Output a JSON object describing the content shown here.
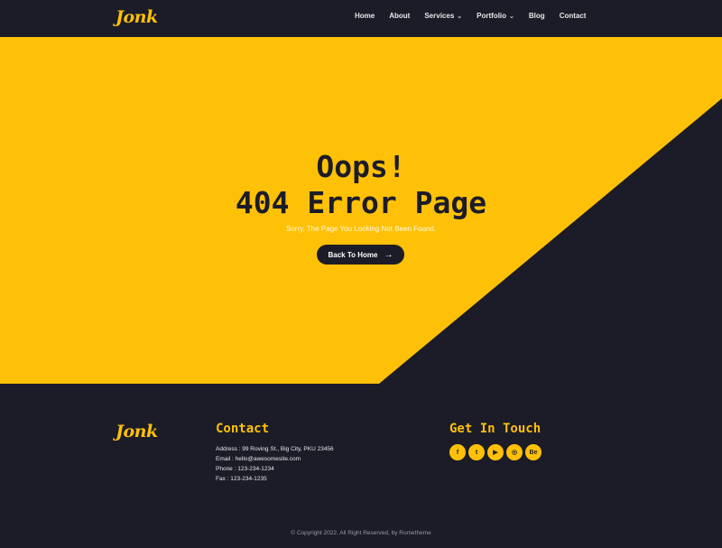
{
  "header": {
    "logo": "Jonk",
    "nav": [
      {
        "label": "Home"
      },
      {
        "label": "About"
      },
      {
        "label": "Services",
        "dropdown": true
      },
      {
        "label": "Portfolio",
        "dropdown": true
      },
      {
        "label": "Blog"
      },
      {
        "label": "Contact"
      }
    ]
  },
  "hero": {
    "title_line1": "Oops!",
    "title_line2": "404 Error Page",
    "subtitle": "Sorry, The Page You Looking Not Been Found.",
    "button_label": "Back To Home"
  },
  "footer": {
    "logo": "Jonk",
    "contact_heading": "Contact",
    "contact_lines": [
      "Address : 99 Roving St., Big City, PKU 23456",
      "Email : hello@awesomesite.com",
      "Phone : 123-234-1234",
      "Fax : 123-234-1235"
    ],
    "touch_heading": "Get In Touch",
    "socials": [
      {
        "icon": "facebook-icon",
        "glyph": "f"
      },
      {
        "icon": "twitter-icon",
        "glyph": "t"
      },
      {
        "icon": "youtube-icon",
        "glyph": "▶"
      },
      {
        "icon": "dribbble-icon",
        "glyph": "◎"
      },
      {
        "icon": "behance-icon",
        "glyph": "Be"
      }
    ],
    "copyright": "© Copyright 2022. All Right Reserved, by Rometheme"
  },
  "colors": {
    "accent": "#ffc107",
    "dark": "#1c1c28"
  }
}
